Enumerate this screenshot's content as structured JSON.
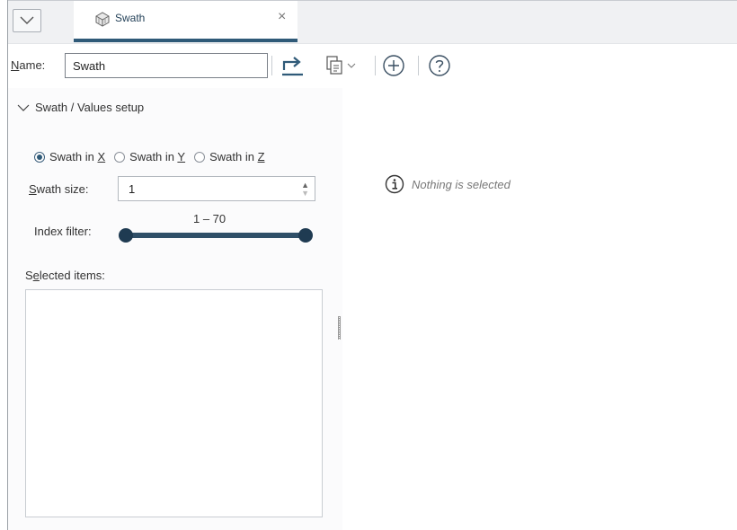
{
  "tab": {
    "label": "Swath",
    "close": "×"
  },
  "toolbar": {
    "name_label_mnemonic": "N",
    "name_label_rest": "ame:",
    "name_value": "Swath"
  },
  "section": {
    "title": "Swath / Values setup"
  },
  "radios": [
    {
      "prefix": "Swath in ",
      "mnemonic": "X",
      "checked": true
    },
    {
      "prefix": "Swath in ",
      "mnemonic": "Y",
      "checked": false
    },
    {
      "prefix": "Swath in ",
      "mnemonic": "Z",
      "checked": false
    }
  ],
  "swath_size": {
    "label_mnemonic": "S",
    "label_rest": "wath size:",
    "value": "1"
  },
  "index_filter": {
    "label": "Index filter:",
    "range_text": "1 – 70",
    "min": 1,
    "max": 70
  },
  "selected_items": {
    "label_start": "S",
    "label_mnemonic": "e",
    "label_rest": "lected items:"
  },
  "info": {
    "text": "Nothing is selected"
  },
  "colors": {
    "accent": "#2f5a78",
    "slider": "#1f3b52"
  }
}
